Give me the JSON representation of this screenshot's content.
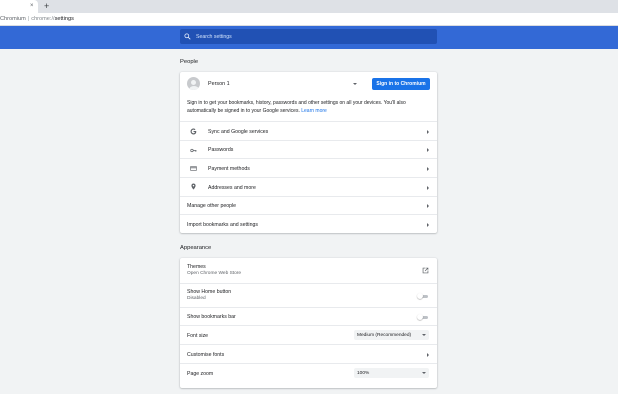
{
  "browser": {
    "tab_close_glyph": "×",
    "new_tab_glyph": "+",
    "url_host": "Chromium",
    "url_separator": "|",
    "url_scheme": "chrome://",
    "url_path": "settings"
  },
  "header": {
    "search_placeholder": "Search settings",
    "color": "#3369d6"
  },
  "people": {
    "title": "People",
    "person_name": "Person 1",
    "signin_button": "Sign in to Chromium",
    "info_text": "Sign in to get your bookmarks, history, passwords and other settings on all your devices. You'll also automatically be signed in to your Google services.",
    "learn_more": "Learn more",
    "rows": [
      {
        "label": "Sync and Google services",
        "icon": "google-icon"
      },
      {
        "label": "Passwords",
        "icon": "key-icon"
      },
      {
        "label": "Payment methods",
        "icon": "credit-card-icon"
      },
      {
        "label": "Addresses and more",
        "icon": "location-pin-icon"
      }
    ],
    "manage_other_people": "Manage other people",
    "import_bookmarks": "Import bookmarks and settings"
  },
  "appearance": {
    "title": "Appearance",
    "themes_label": "Themes",
    "themes_sub": "Open Chrome Web Store",
    "home_button_label": "Show Home button",
    "home_button_sub": "Disabled",
    "bookmarks_bar_label": "Show bookmarks bar",
    "font_size_label": "Font size",
    "font_size_value": "Medium (Recommended)",
    "customise_fonts_label": "Customise fonts",
    "page_zoom_label": "Page zoom",
    "page_zoom_value": "100%"
  }
}
